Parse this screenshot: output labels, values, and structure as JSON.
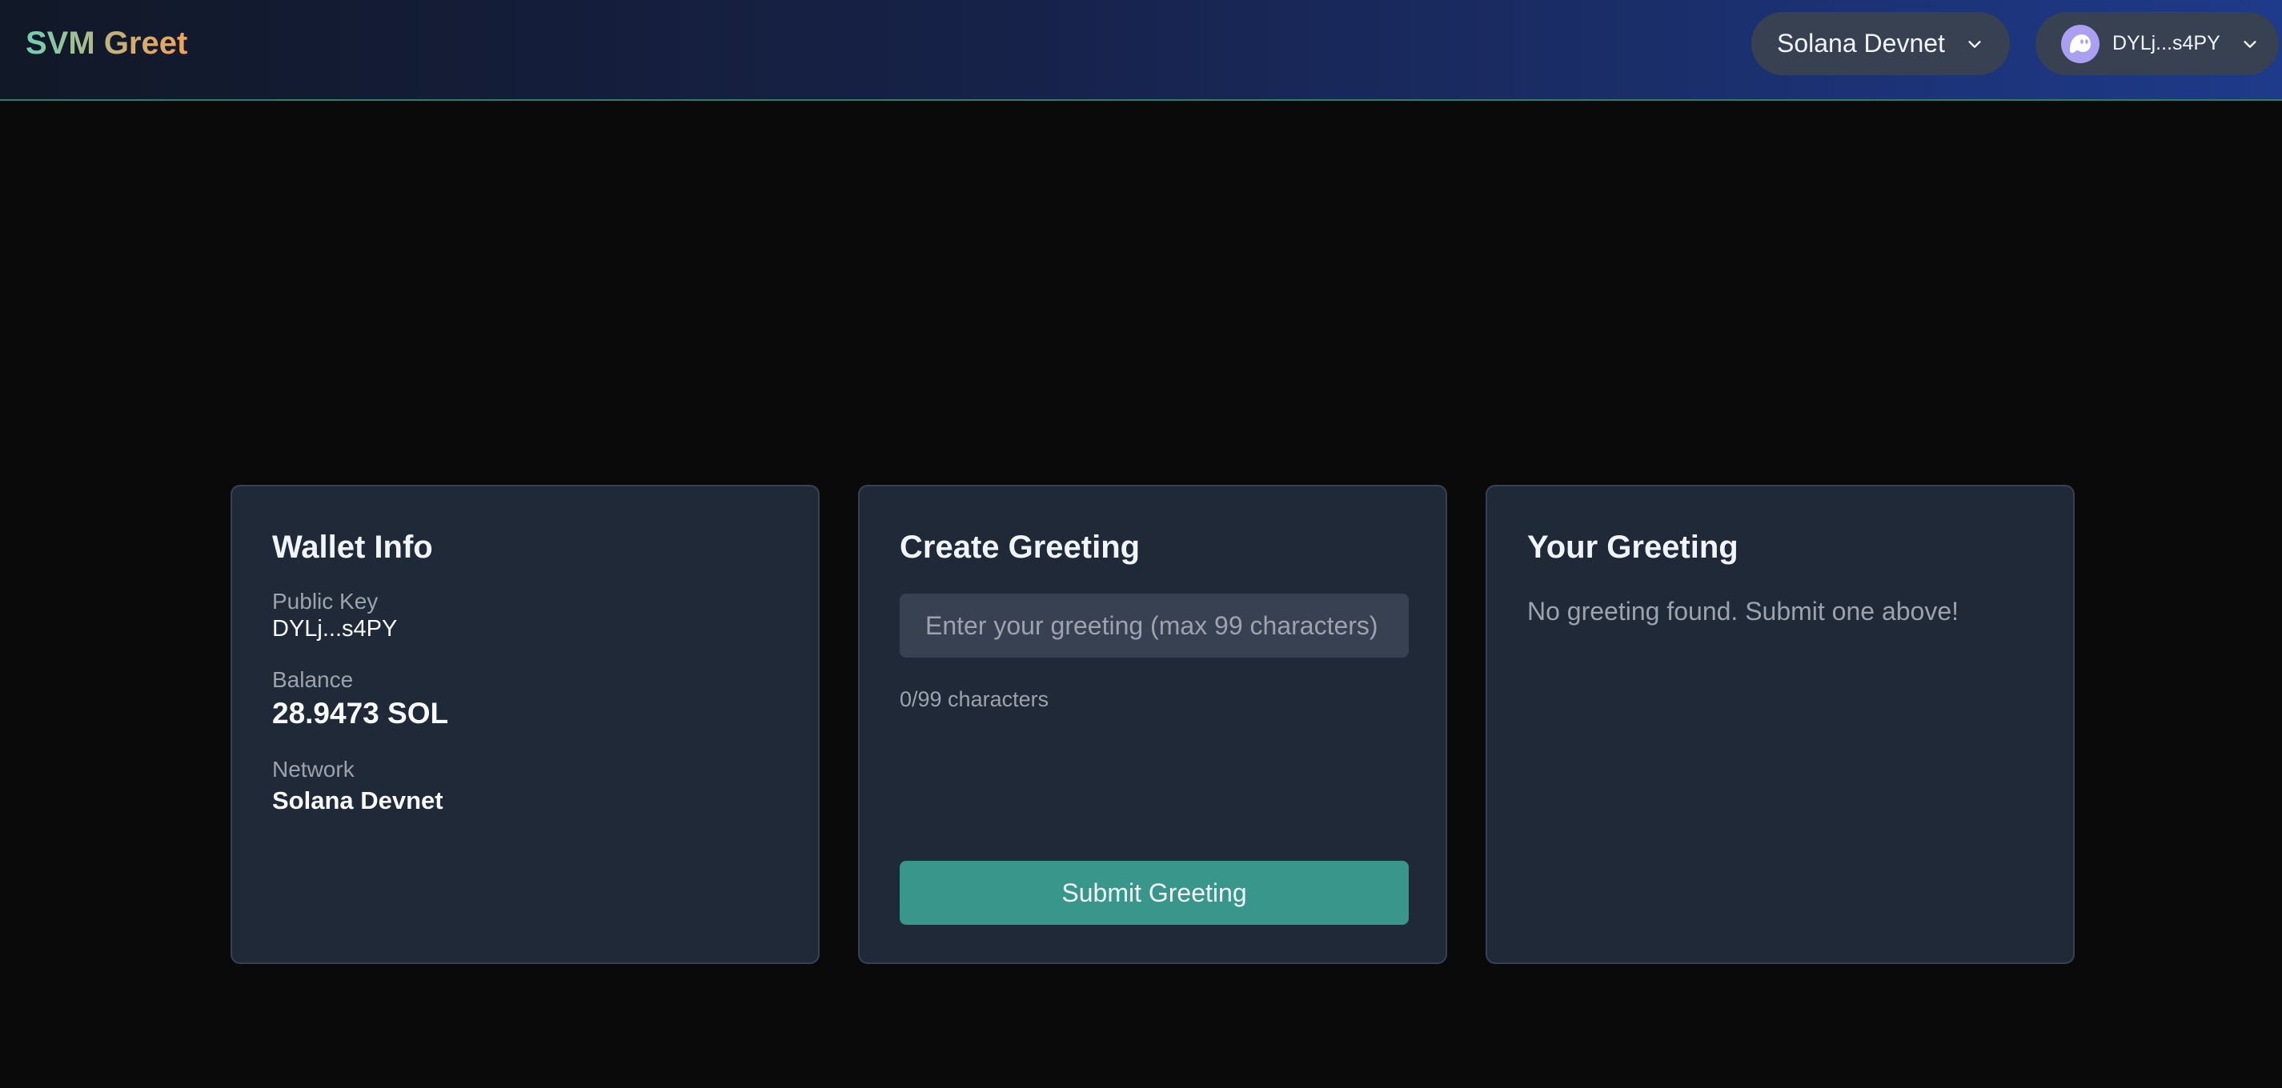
{
  "header": {
    "brand_part1": "SVM",
    "brand_part2": "Greet",
    "network_selector": {
      "label": "Solana Devnet",
      "icon": "chevron-down-icon"
    },
    "wallet_button": {
      "label": "DYLj...s4PY",
      "avatar_icon": "phantom-ghost-icon",
      "icon": "chevron-down-icon"
    }
  },
  "wallet_info": {
    "title": "Wallet Info",
    "public_key_label": "Public Key",
    "public_key_value": "DYLj...s4PY",
    "balance_label": "Balance",
    "balance_value": "28.9473 SOL",
    "network_label": "Network",
    "network_value": "Solana Devnet"
  },
  "create_greeting": {
    "title": "Create Greeting",
    "input_value": "",
    "input_placeholder": "Enter your greeting (max 99 characters)",
    "char_count": "0/99 characters",
    "submit_label": "Submit Greeting"
  },
  "your_greeting": {
    "title": "Your Greeting",
    "empty_message": "No greeting found. Submit one above!"
  },
  "colors": {
    "background": "#0a0a0a",
    "card": "#1f2937",
    "accent": "#38978a",
    "muted_text": "#9ca3af"
  }
}
